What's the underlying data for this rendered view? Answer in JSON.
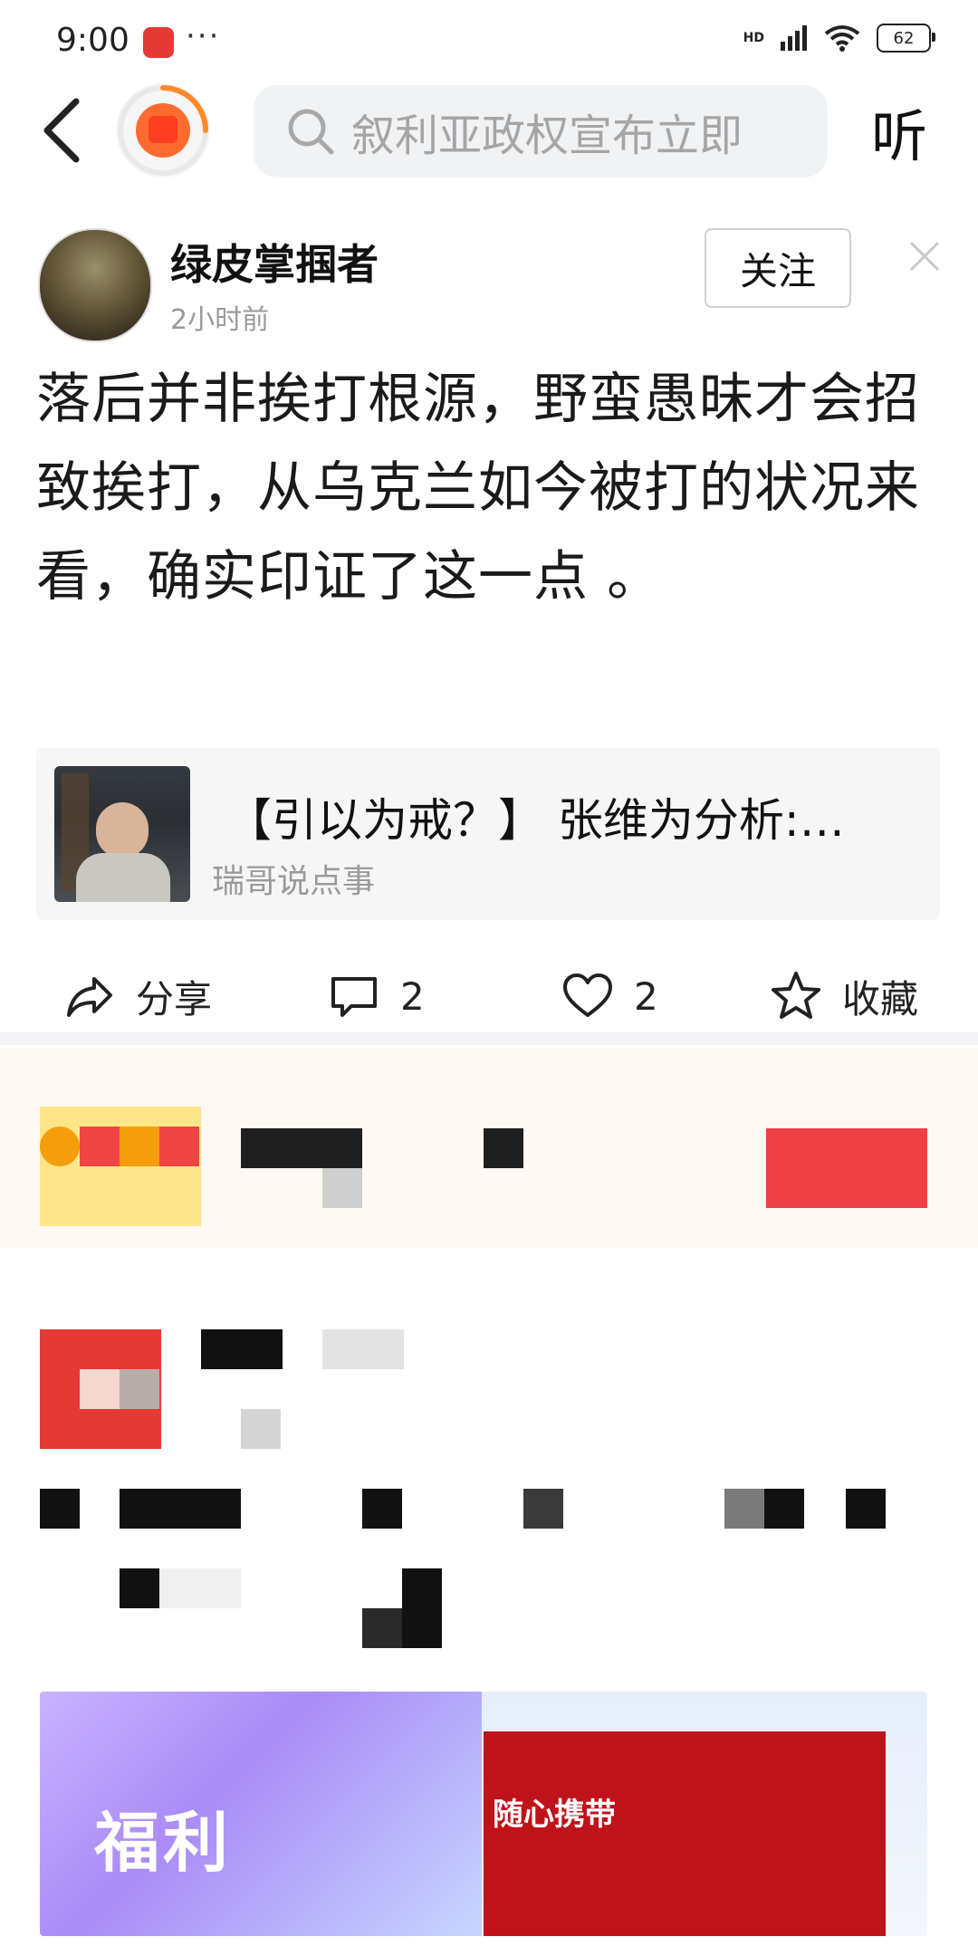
{
  "status_bar": {
    "time": "9:00",
    "dots": "···",
    "hd": "HD",
    "battery": "62"
  },
  "top_nav": {
    "search_placeholder": "叙利亚政权宣布立即",
    "listen_label": "听"
  },
  "post": {
    "author_name": "绿皮掌掴者",
    "time_ago": "2小时前",
    "follow_label": "关注",
    "body": "落后并非挨打根源，野蛮愚昧才会招致挨打，从乌克兰如今被打的状况来看，确实印证了这一点 。"
  },
  "video_card": {
    "title": "【引以为戒？】 张维为分析:…",
    "source": "瑞哥说点事"
  },
  "actions": {
    "share_label": "分享",
    "comment_count": "2",
    "like_count": "2",
    "favorite_label": "收藏"
  },
  "ad_banner": {
    "title": "福利",
    "subtitle": "随心携带"
  },
  "colors": {
    "accent_red": "#e53935",
    "banner_red": "#c0121a",
    "ad_red": "#ee3f45"
  },
  "icons": [
    "back-icon",
    "red-packet-icon",
    "search-icon",
    "close-icon",
    "share-icon",
    "comment-icon",
    "like-icon",
    "star-icon"
  ]
}
